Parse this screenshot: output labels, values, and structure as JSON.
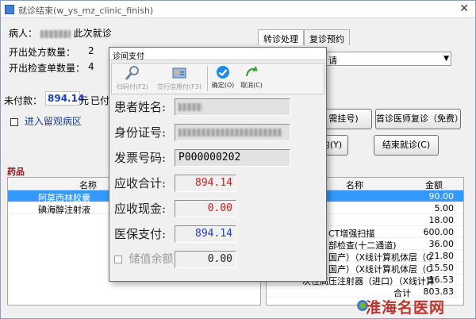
{
  "window": {
    "title": "就诊结束(w_ys_mz_clinic_finish)",
    "close_glyph": "✕"
  },
  "patient": {
    "label": "病人：",
    "suffix": "此次就诊"
  },
  "counts": [
    {
      "label": "开出处方数量：",
      "value": "2"
    },
    {
      "label": "开出检查单数量：",
      "value": "4"
    }
  ],
  "unpaid": {
    "label": "未付款：",
    "amount": "894.14",
    "unit": "元",
    "paid_label": "已付"
  },
  "observe": {
    "checkbox_label": "进入留观病区"
  },
  "tabs": [
    {
      "label": "转诊处理"
    },
    {
      "label": "复诊预约"
    }
  ],
  "combo": {
    "value": "请",
    "arrow": "▼"
  },
  "buttons": {
    "need_register_suffix": "需挂号)",
    "first_doctor_revisit": "首诊医师复诊（免费）",
    "appointment_suffix": "约(Y)",
    "end_visit": "结束就诊(C)"
  },
  "section_title": "药品",
  "left_table": {
    "columns": [
      "名称"
    ],
    "rows": [
      {
        "name": "阿莫西林胶囊",
        "selected": true
      },
      {
        "name": "碘海醇注射液",
        "selected": false
      }
    ]
  },
  "right_table": {
    "columns": [
      "名称",
      "金额"
    ],
    "rows": [
      {
        "name": "",
        "amount": "90.00",
        "selected": true
      },
      {
        "name": "",
        "amount": "5.00"
      },
      {
        "name": "",
        "amount": "18.00"
      },
      {
        "name": "CT增强扫描",
        "amount": "600.00"
      },
      {
        "name": "部检查(十二通道)",
        "amount": "36.00"
      },
      {
        "name": "国产）（X线计算机体层（C",
        "amount": "21.80"
      },
      {
        "name": "国产）（X线计算机体层（C",
        "amount": "15.50"
      },
      {
        "name": "一次性高压注射器（进口）（X线计算",
        "amount": "16.53"
      }
    ],
    "total_label": "合计",
    "total_value": "803.83"
  },
  "modal": {
    "title": "诊间支付",
    "toolbar": [
      {
        "label": "扫码付(F2)",
        "enabled": false
      },
      {
        "label": "交行信用付(F3)",
        "enabled": false
      },
      {
        "label": "确定(O)",
        "enabled": true
      },
      {
        "label": "取消(C)",
        "enabled": true
      }
    ],
    "fields": [
      {
        "label": "患者姓名:",
        "value": ""
      },
      {
        "label": "身份证号:",
        "value": ""
      },
      {
        "label": "发票号码:",
        "value": "P000000202"
      },
      {
        "label": "应收合计:",
        "value": "894.14",
        "color": "#d01a1a"
      },
      {
        "label": "应收现金:",
        "value": "0.00",
        "color": "#d01a1a"
      },
      {
        "label": "医保支付:",
        "value": "894.14",
        "color": "#1a3cc8"
      },
      {
        "label": "储值余额",
        "value": "0.00",
        "color": "#222222"
      }
    ]
  },
  "watermark": {
    "text": "淮海名医网"
  }
}
